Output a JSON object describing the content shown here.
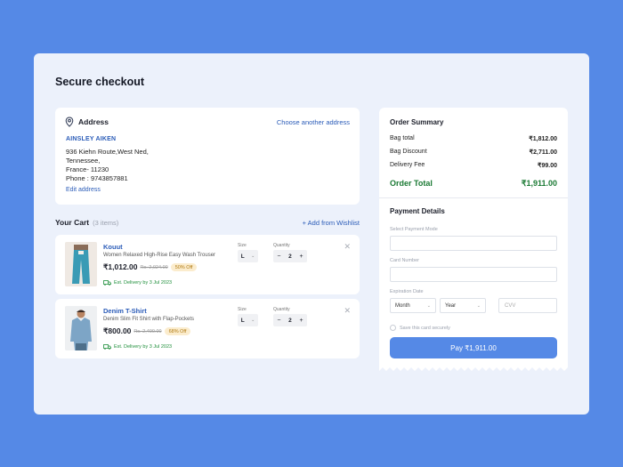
{
  "page": {
    "title": "Secure checkout"
  },
  "address": {
    "label": "Address",
    "choose_link": "Choose another address",
    "name": "AINSLEY AIKEN",
    "line1": "936 Kiehn Route,West Ned,",
    "line2": "Tennessee,",
    "line3": "France- 11230",
    "phone": "Phone : 9743857881",
    "edit_link": "Edit address"
  },
  "cart": {
    "title": "Your Cart",
    "count": "(3 items)",
    "add_wishlist": "+ Add from Wishlist",
    "size_label": "Size",
    "qty_label": "Quantity",
    "items": [
      {
        "brand": "Kouut",
        "description": "Women Relaxed High-Rise Easy Wash Trouser",
        "price": "₹1,012.00",
        "mrp": "Rs. 2,024.00",
        "discount": "50% Off",
        "delivery": "Est. Delivery by 3 Jul 2023",
        "size": "L",
        "quantity": "2"
      },
      {
        "brand": "Denim T-Shirt",
        "description": "Denim Slim Fit Shirt with Flap-Pockets",
        "price": "₹800.00",
        "mrp": "Rs. 2,490.00",
        "discount": "68% Off",
        "delivery": "Est. Delivery by 3 Jul 2023",
        "size": "L",
        "quantity": "2"
      }
    ]
  },
  "summary": {
    "title": "Order Summary",
    "rows": [
      {
        "label": "Bag total",
        "value": "₹1,812.00"
      },
      {
        "label": "Bag Discount",
        "value": "₹2,711.00"
      },
      {
        "label": "Delivery Fee",
        "value": "₹99.00"
      }
    ],
    "total_label": "Order Total",
    "total_value": "₹1,911.00"
  },
  "payment": {
    "title": "Payment Details",
    "mode_label": "Select Payment Mode",
    "card_label": "Card Number",
    "expiry_label": "Expiration Date",
    "month": "Month",
    "year": "Year",
    "cvv": "CVV",
    "save_card": "Save this card securely",
    "pay_button": "Pay ₹1,911.00"
  },
  "colors": {
    "accent": "#5589e6",
    "link": "#2b5cb8",
    "success": "#1b7a34",
    "badge_bg": "#fbeccd"
  },
  "icons": [
    "location-pin-icon",
    "truck-icon",
    "close-icon",
    "chevron-down-icon",
    "minus-icon",
    "plus-icon"
  ]
}
